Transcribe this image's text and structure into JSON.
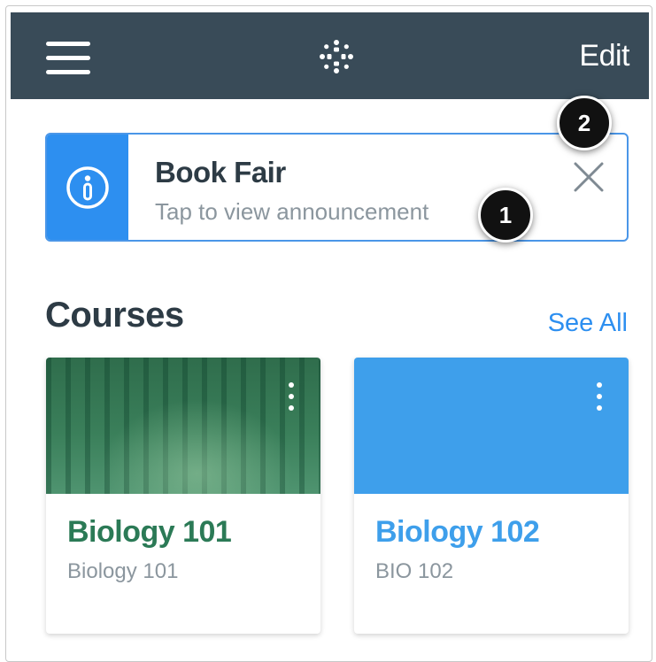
{
  "header": {
    "menu_icon": "hamburger-menu-icon",
    "logo_icon": "canvas-logo-icon",
    "edit_label": "Edit",
    "background": "#394b58"
  },
  "announcement": {
    "icon": "info-icon",
    "title": "Book Fair",
    "subtitle": "Tap to view announcement",
    "dismiss_icon": "close-icon",
    "accent": "#2d8ff0"
  },
  "callouts": [
    "1",
    "2"
  ],
  "courses": {
    "heading": "Courses",
    "see_all_label": "See All",
    "cards": [
      {
        "name": "Biology 101",
        "code": "Biology 101",
        "color": "#2b7a56",
        "image": "forest-photo",
        "menu_icon": "more-vertical-icon"
      },
      {
        "name": "Biology 102",
        "code": "BIO 102",
        "color": "#3e9feb",
        "menu_icon": "more-vertical-icon"
      }
    ]
  }
}
